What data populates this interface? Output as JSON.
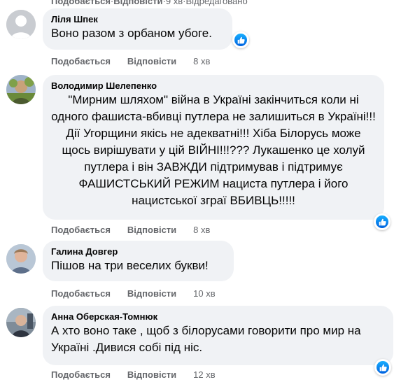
{
  "top_partial": {
    "like": "Подобається",
    "reply": "Відповісти",
    "time": "9 хв",
    "extra": "Відредаговано"
  },
  "comments": [
    {
      "author": "Ліля Шпек",
      "text": "Воно разом з орбаном убоге.",
      "like": "Подобається",
      "reply": "Відповісти",
      "time": "8 хв",
      "has_like_reaction": true
    },
    {
      "author": "Володимир Шелепенко",
      "text": "\"Мирним шляхом\" війна в Україні закінчиться коли ні одного фашиста-вбивці путлера не залишиться в Україні!!! Дії Угорщини якісь не адекватні!!! Хіба Білорусь може щось вирішувати у цій ВІЙНІ!!!??? Лукашенко це холуй путлера і він ЗАВЖДИ підтримував і підтримує ФАШИСТСЬКИЙ РЕЖИМ нациста путлера і його нацистської зграї ВБИВЦЬ!!!!!",
      "like": "Подобається",
      "reply": "Відповісти",
      "time": "8 хв",
      "has_like_reaction": true
    },
    {
      "author": "Галина Довгер",
      "text": "Пішов на три веселих букви!",
      "like": "Подобається",
      "reply": "Відповісти",
      "time": "10 хв",
      "has_like_reaction": false
    },
    {
      "author": "Анна Оберская-Томнюк",
      "text": "А хто воно таке , щоб з білорусами говорити про мир на Україні .Дивися собі під ніс.",
      "like": "Подобається",
      "reply": "Відповісти",
      "time": "12 хв",
      "has_like_reaction": true
    }
  ],
  "icons": {
    "like_reaction": "thumbs-up-icon"
  },
  "colors": {
    "bubble_bg": "#f0f2f5",
    "meta_text": "#65676b",
    "like_blue": "#0866ff"
  }
}
